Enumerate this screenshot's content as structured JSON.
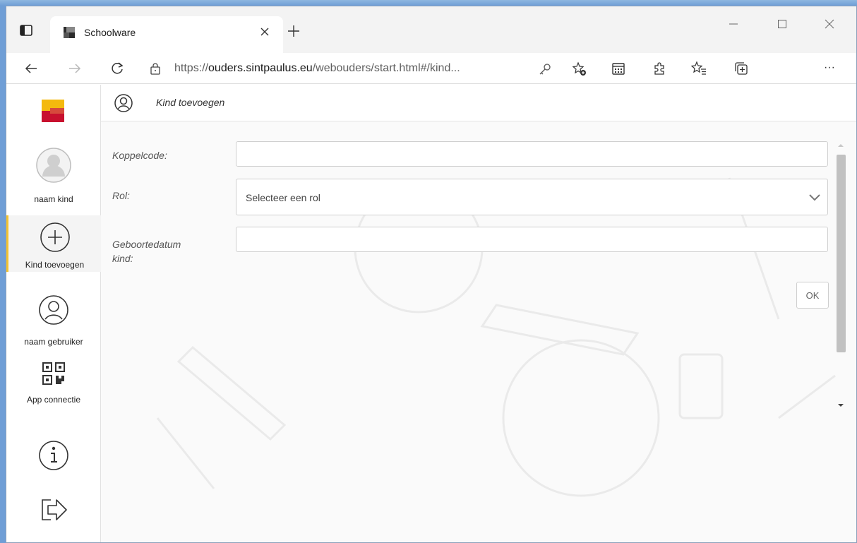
{
  "browser": {
    "tab_title": "Schoolware",
    "new_tab_symbol": "+",
    "url_prefix": "https://",
    "url_host": "ouders.sintpaulus.eu",
    "url_path": "/webouders/start.html#/kind...",
    "more_label": "···"
  },
  "sidebar": {
    "child_label": "naam kind",
    "add_child_label": "Kind toevoegen",
    "user_label": "naam gebruiker",
    "app_label": "App connectie"
  },
  "header": {
    "title": "Kind toevoegen"
  },
  "form": {
    "koppelcode_label": "Koppelcode:",
    "koppelcode_value": "",
    "rol_label": "Rol:",
    "rol_value": "Selecteer een rol",
    "geboortedatum_label_line1": "Geboortedatum",
    "geboortedatum_label_line2": "kind:",
    "geboortedatum_value": "",
    "ok_label": "OK"
  },
  "colors": {
    "accent": "#f2c230",
    "logo_yellow": "#f4b90e",
    "logo_red": "#c8102e"
  },
  "icons": {
    "tab_actions": "tab-actions-icon",
    "back": "back-arrow-icon",
    "forward": "forward-arrow-icon",
    "refresh": "refresh-icon",
    "lock": "lock-icon",
    "key": "key-icon",
    "favorite_add": "favorite-add-icon",
    "calendar_ext": "calendar-extension-icon",
    "extensions": "extensions-icon",
    "favorites": "favorites-icon",
    "collections": "collections-icon",
    "user": "user-icon",
    "add": "add-circle-icon",
    "qr": "qr-code-icon",
    "info": "info-icon",
    "logout": "logout-icon"
  }
}
